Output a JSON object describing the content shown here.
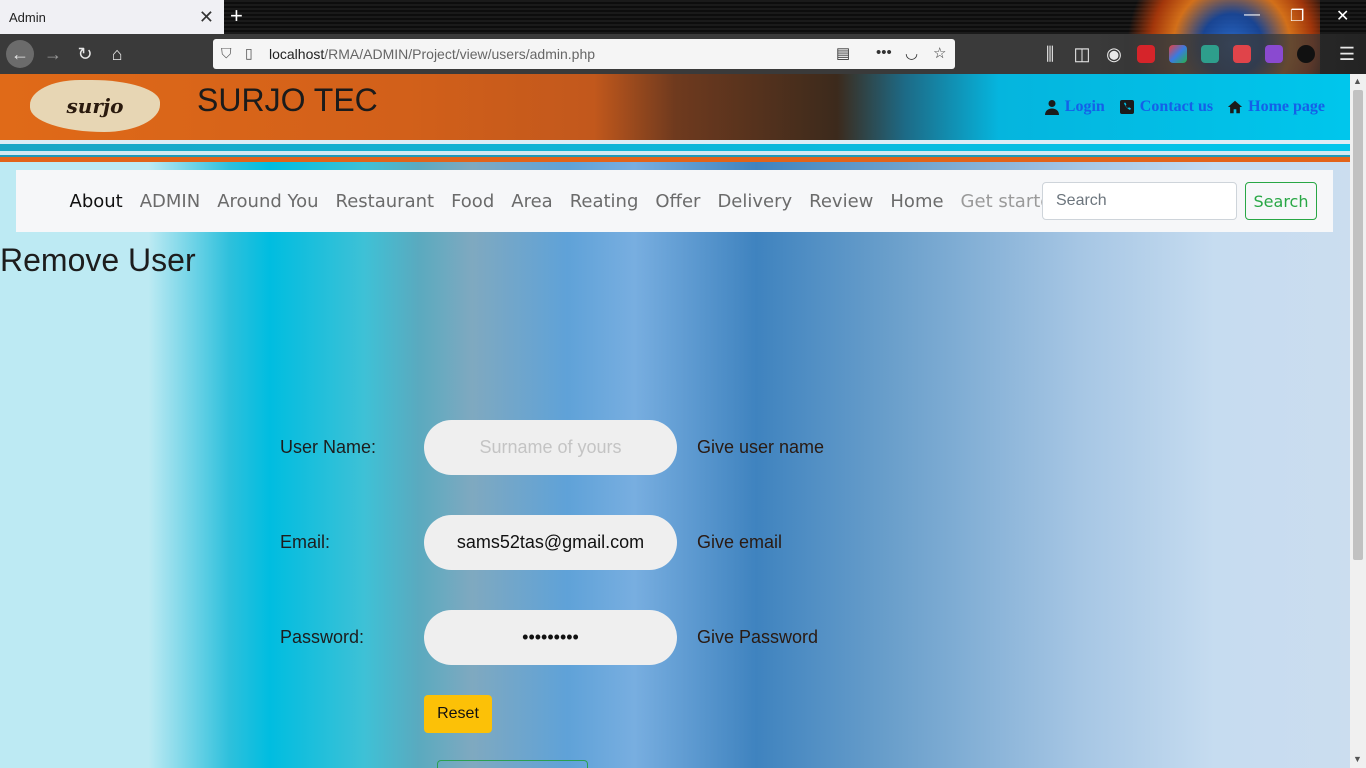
{
  "browser": {
    "tab_title": "Admin",
    "tab_close": "✕",
    "new_tab": "+",
    "url_host": "localhost",
    "url_path": "/RMA/ADMIN/Project/view/users/admin.php",
    "window_controls": {
      "minimize": "—",
      "maximize": "❐",
      "close": "✕"
    },
    "nav_icons": {
      "back": "←",
      "forward": "→",
      "reload": "↻",
      "home": "⌂"
    },
    "url_icons": {
      "reader": "▤",
      "more": "•••",
      "pocket": "◡",
      "bookmark": "☆"
    },
    "toolbar_icons": {
      "library": "⫼",
      "sidebar": "◫",
      "account": "◉",
      "menu": "☰"
    }
  },
  "header": {
    "logo_text": "surjo",
    "brand": "SURJO TEC",
    "links": [
      {
        "label": "Login",
        "icon": "user-icon"
      },
      {
        "label": "Contact us",
        "icon": "phone-icon"
      },
      {
        "label": "Home page",
        "icon": "home-icon"
      }
    ]
  },
  "menu": {
    "items": [
      "About",
      "ADMIN",
      "Around You",
      "Restaurant",
      "Food",
      "Area",
      "Reating",
      "Offer",
      "Delivery",
      "Review",
      "Home",
      "Get started"
    ],
    "active": "About",
    "search_placeholder": "Search",
    "search_button": "Search"
  },
  "page": {
    "title": "Remove User"
  },
  "form": {
    "username": {
      "label": "User Name:",
      "placeholder": "Surname of yours",
      "value": "",
      "hint": "Give user name"
    },
    "email": {
      "label": "Email:",
      "placeholder": "",
      "value": "sams52tas@gmail.com",
      "hint": "Give email"
    },
    "password": {
      "label": "Password:",
      "placeholder": "",
      "value": "abcdefghi",
      "hint": "Give Password"
    },
    "reset_label": "Reset"
  },
  "colors": {
    "accent_link": "#1460e8",
    "reset_button": "#fcc107",
    "search_button": "#28a745"
  }
}
